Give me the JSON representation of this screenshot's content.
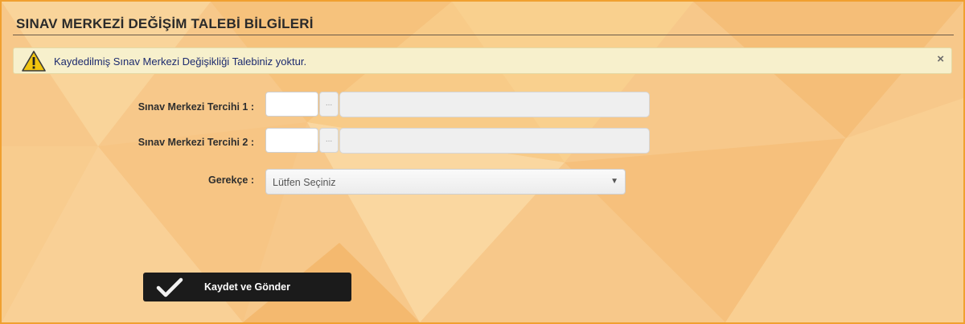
{
  "header": {
    "title": "SINAV MERKEZİ DEĞİŞİM TALEBİ BİLGİLERİ"
  },
  "alert": {
    "icon": "warning-icon",
    "message": "Kaydedilmiş Sınav Merkezi Değişikliği Talebiniz yoktur.",
    "close_label": "×"
  },
  "form": {
    "preference1": {
      "label": "Sınav Merkezi Tercihi 1 :",
      "code_value": "",
      "browse_label": "...",
      "name_value": ""
    },
    "preference2": {
      "label": "Sınav Merkezi Tercihi 2 :",
      "code_value": "",
      "browse_label": "...",
      "name_value": ""
    },
    "reason": {
      "label": "Gerekçe :",
      "selected": "Lütfen Seçiniz",
      "arrow": "▼"
    }
  },
  "actions": {
    "submit_label": "Kaydet ve Gönder",
    "submit_icon": "checkmark-icon"
  }
}
